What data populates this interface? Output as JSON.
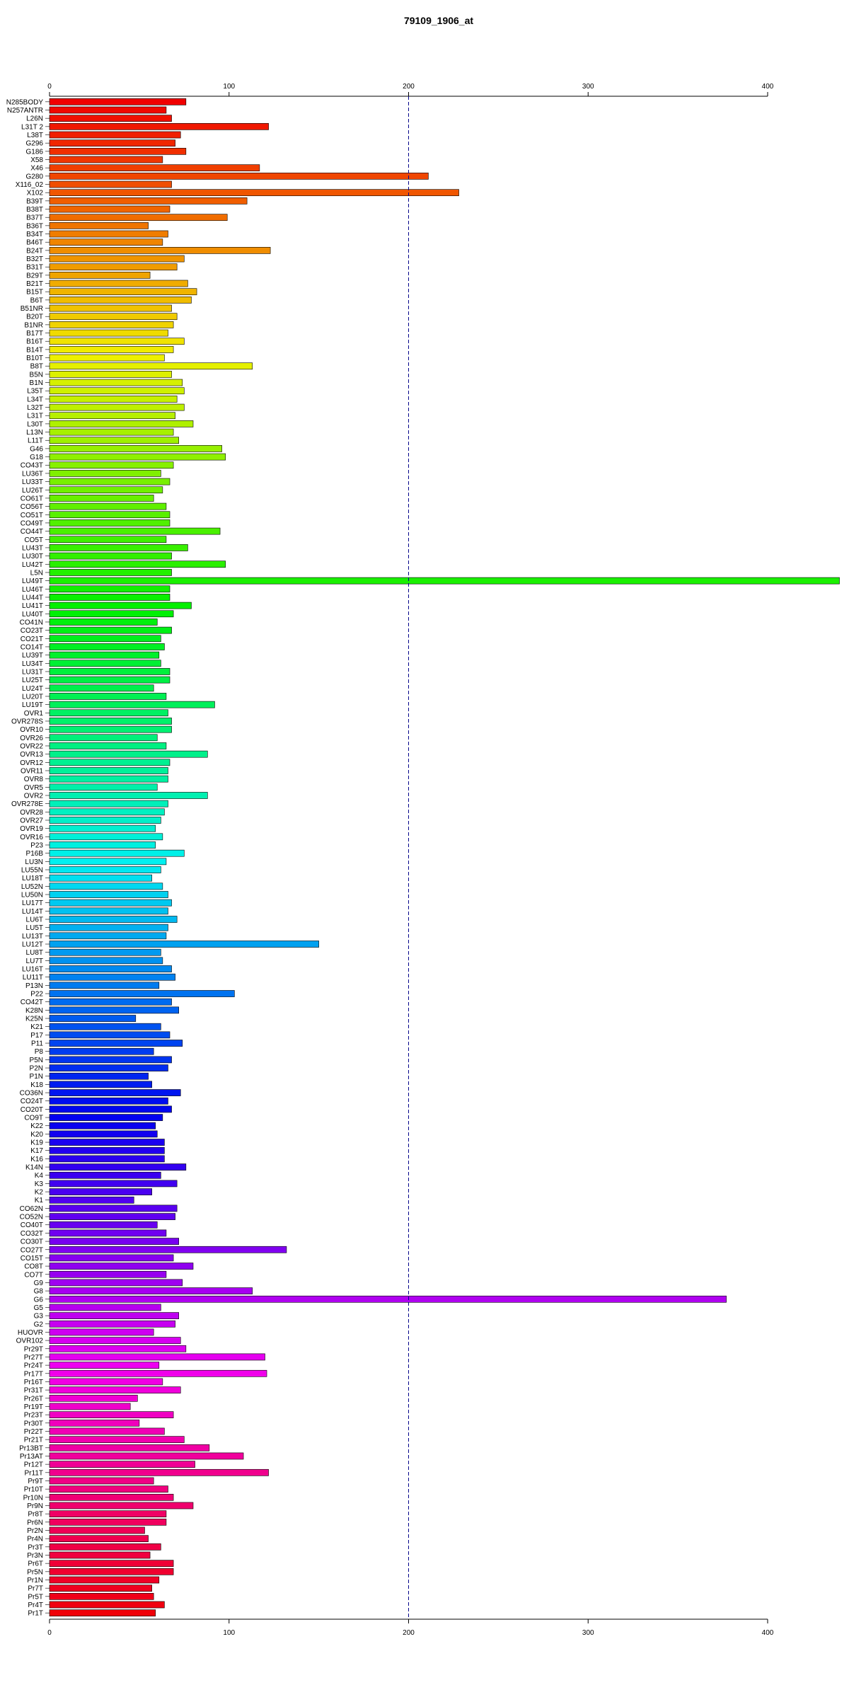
{
  "chart_data": {
    "type": "bar",
    "orientation": "horizontal",
    "title": "79109_1906_at",
    "xlabel": "",
    "ylabel": "",
    "xlim": [
      0,
      400
    ],
    "x_ticks": [
      0,
      100,
      200,
      300,
      400
    ],
    "x_tick_labels": [
      "0",
      "100",
      "200",
      "300",
      "400"
    ],
    "reference_line": {
      "x": 200,
      "style": "dashed",
      "color": "#00008b"
    },
    "grid": false,
    "legend": "none",
    "color_scheme": "rainbow",
    "categories": [
      "N285BODY",
      "N257ANTR",
      "L26N",
      "L31T 2",
      "L38T",
      "G296",
      "G186",
      "X58",
      "X46",
      "G280",
      "X116_02",
      "X102",
      "B39T",
      "B38T",
      "B37T",
      "B36T",
      "B34T",
      "B46T",
      "B24T",
      "B32T",
      "B31T",
      "B29T",
      "B21T",
      "B15T",
      "B6T",
      "B51NR",
      "B20T",
      "B1NR",
      "B17T",
      "B16T",
      "B14T",
      "B10T",
      "B8T",
      "B5N",
      "B1N",
      "L35T",
      "L34T",
      "L32T",
      "L31T",
      "L30T",
      "L13N",
      "L11T",
      "G46",
      "G18",
      "CO43T",
      "LU36T",
      "LU33T",
      "LU26T",
      "CO61T",
      "CO56T",
      "CO51T",
      "CO49T",
      "CO44T",
      "CO5T",
      "LU43T",
      "LU30T",
      "LU42T",
      "L5N",
      "LU49T",
      "LU46T",
      "LU44T",
      "LU41T",
      "LU40T",
      "CO41N",
      "CO23T",
      "CO21T",
      "CO14T",
      "LU39T",
      "LU34T",
      "LU31T",
      "LU25T",
      "LU24T",
      "LU20T",
      "LU19T",
      "OVR1",
      "OVR278S",
      "OVR10",
      "OVR26",
      "OVR22",
      "OVR13",
      "OVR12",
      "OVR11",
      "OVR8",
      "OVR5",
      "OVR2",
      "OVR278E",
      "OVR28",
      "OVR27",
      "OVR19",
      "OVR16",
      "P23",
      "P16B",
      "LU3N",
      "LU55N",
      "LU18T",
      "LU52N",
      "LU50N",
      "LU17T",
      "LU14T",
      "LU6T",
      "LU5T",
      "LU13T",
      "LU12T",
      "LU8T",
      "LU7T",
      "LU16T",
      "LU11T",
      "P13N",
      "P22",
      "CO42T",
      "K28N",
      "K25N",
      "K21",
      "P17",
      "P11",
      "P8",
      "P5N",
      "P2N",
      "P1N",
      "K18",
      "CO36N",
      "CO24T",
      "CO20T",
      "CO9T",
      "K22",
      "K20",
      "K19",
      "K17",
      "K16",
      "K14N",
      "K4",
      "K3",
      "K2",
      "K1",
      "CO62N",
      "CO52N",
      "CO40T",
      "CO32T",
      "CO30T",
      "CO27T",
      "CO15T",
      "CO8T",
      "CO7T",
      "G9",
      "G8",
      "G6",
      "G5",
      "G3",
      "G2",
      "HUOVR",
      "OVR102",
      "Pr29T",
      "Pr27T",
      "Pr24T",
      "Pr17T",
      "Pr16T",
      "Pr31T",
      "Pr26T",
      "Pr19T",
      "Pr23T",
      "Pr30T",
      "Pr22T",
      "Pr21T",
      "Pr13BT",
      "Pr13AT",
      "Pr12T",
      "Pr11T",
      "Pr9T",
      "Pr10T",
      "Pr10N",
      "Pr9N",
      "Pr8T",
      "Pr6N",
      "Pr2N",
      "Pr4N",
      "Pr3T",
      "Pr3N",
      "Pr6T",
      "Pr5N",
      "Pr1N",
      "Pr7T",
      "Pr5T",
      "Pr4T",
      "Pr1T"
    ],
    "values": [
      76,
      65,
      68,
      122,
      73,
      70,
      76,
      63,
      117,
      211,
      68,
      228,
      110,
      67,
      99,
      55,
      66,
      63,
      123,
      75,
      71,
      56,
      77,
      82,
      79,
      68,
      71,
      69,
      66,
      75,
      69,
      64,
      113,
      68,
      74,
      75,
      71,
      75,
      70,
      80,
      69,
      72,
      96,
      98,
      69,
      62,
      67,
      63,
      58,
      65,
      67,
      67,
      95,
      65,
      77,
      68,
      98,
      68,
      440,
      67,
      67,
      79,
      69,
      60,
      68,
      62,
      64,
      61,
      62,
      67,
      67,
      58,
      65,
      92,
      66,
      68,
      68,
      60,
      65,
      88,
      67,
      66,
      66,
      60,
      88,
      66,
      64,
      62,
      59,
      63,
      59,
      75,
      65,
      62,
      57,
      63,
      66,
      68,
      66,
      71,
      66,
      65,
      150,
      62,
      63,
      68,
      70,
      61,
      103,
      68,
      72,
      48,
      62,
      67,
      74,
      58,
      68,
      66,
      55,
      57,
      73,
      66,
      68,
      63,
      59,
      60,
      64,
      64,
      64,
      76,
      62,
      71,
      57,
      47,
      71,
      70,
      60,
      65,
      72,
      132,
      69,
      80,
      65,
      74,
      113,
      377,
      62,
      72,
      70,
      58,
      73,
      76,
      120,
      61,
      121,
      63,
      73,
      49,
      45,
      69,
      50,
      64,
      75,
      89,
      108,
      81,
      122,
      58,
      66,
      69,
      80,
      65,
      65,
      53,
      55,
      62,
      56,
      69,
      69,
      61,
      57,
      58,
      64,
      59
    ]
  }
}
